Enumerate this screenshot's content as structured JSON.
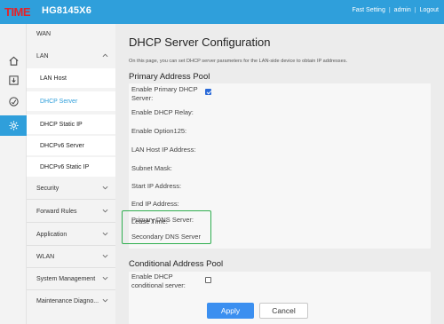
{
  "header": {
    "logo_text": "TIME",
    "model": "HG8145X6",
    "fast_setting": "Fast Setting",
    "separator": "|",
    "admin": "admin",
    "logout": "Logout",
    "brand_color": "#2f9fdb"
  },
  "rail": {
    "icons": [
      "home-icon",
      "download-icon",
      "gauge-icon",
      "gear-icon"
    ],
    "active_icon": "gear-icon"
  },
  "menu": {
    "wan": "WAN",
    "lan": "LAN",
    "lan_sub": [
      "LAN Host",
      "DHCP Server",
      "DHCP Static IP",
      "DHCPv6 Server",
      "DHCPv6 Static IP"
    ],
    "active_sub": "DHCP Server",
    "security": "Security",
    "forward_rules": "Forward Rules",
    "application": "Application",
    "wlan": "WLAN",
    "system_management": "System Management",
    "maintenance": "Maintenance Diagno..."
  },
  "main": {
    "title": "DHCP Server Configuration",
    "description": "On this page, you can set DHCP server parameters for the LAN-side device to obtain IP addresses.",
    "primary_pool": {
      "title": "Primary Address Pool",
      "enable_primary_line1": "Enable Primary DHCP",
      "enable_primary_line2": "Server:",
      "enable_primary_checked": true,
      "enable_relay": "Enable DHCP Relay:",
      "enable_option125": "Enable Option125:",
      "lan_host_ip": "LAN Host IP Address:",
      "subnet_mask": "Subnet Mask:",
      "start_ip": "Start IP Address:",
      "end_ip": "End IP Address:",
      "lease_time": "Lease Time:",
      "primary_dns": "Primary DNS Server:",
      "secondary_dns": "Secondary DNS Server"
    },
    "conditional_pool": {
      "title": "Conditional Address Pool",
      "enable_line1": "Enable DHCP",
      "enable_line2": "conditional server:",
      "enable_checked": false
    },
    "apply": "Apply",
    "cancel": "Cancel",
    "highlight_color": "#2fae4f"
  }
}
